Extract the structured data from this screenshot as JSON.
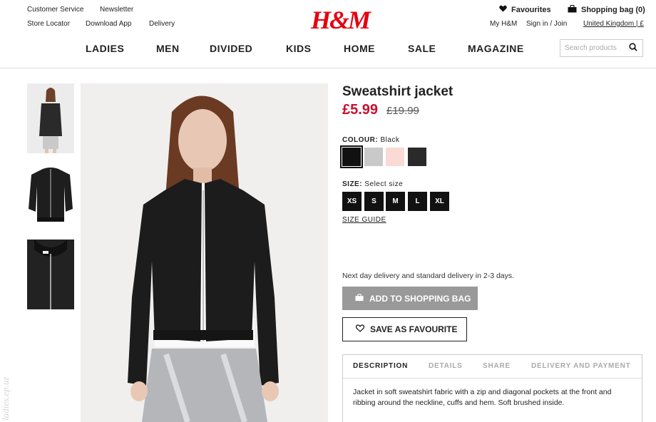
{
  "header": {
    "utility_links": [
      "Customer Service",
      "Newsletter",
      "Store Locator",
      "Download App",
      "Delivery"
    ],
    "logo": "H&M",
    "favourites": "Favourites",
    "shopping_bag": "Shopping bag (0)",
    "my_hm": "My H&M",
    "sign_in": "Sign in / Join",
    "country": "United Kingdom | £"
  },
  "nav": {
    "items": [
      "LADIES",
      "MEN",
      "DIVIDED",
      "KIDS",
      "HOME",
      "SALE",
      "MAGAZINE"
    ]
  },
  "search": {
    "placeholder": "Search products"
  },
  "product": {
    "title": "Sweatshirt jacket",
    "price": "£5.99",
    "old_price": "£19.99",
    "colour_label": "COLOUR:",
    "colour_value": "Black",
    "swatches": [
      "#111111",
      "#c9c9c9",
      "#f9dad4",
      "#2a2a2a"
    ],
    "size_label": "SIZE:",
    "size_value": "Select size",
    "sizes": [
      "XS",
      "S",
      "M",
      "L",
      "XL"
    ],
    "size_guide": "SIZE GUIDE",
    "delivery_text": "Next day delivery and standard delivery in 2-3 days.",
    "add_to_bag": "ADD TO SHOPPING BAG",
    "save_favourite": "SAVE AS FAVOURITE"
  },
  "tabs": {
    "items": [
      "DESCRIPTION",
      "DETAILS",
      "SHARE",
      "DELIVERY AND PAYMENT"
    ],
    "active": "DESCRIPTION",
    "description": "Jacket in soft sweatshirt fabric with a zip and diagonal pockets at the front and ribbing around the neckline, cuffs and hem. Soft brushed inside."
  },
  "watermark": "ladies.ep.uz",
  "colors": {
    "brand_red": "#e50010",
    "price_red": "#c8102e",
    "add_button": "#999999"
  }
}
